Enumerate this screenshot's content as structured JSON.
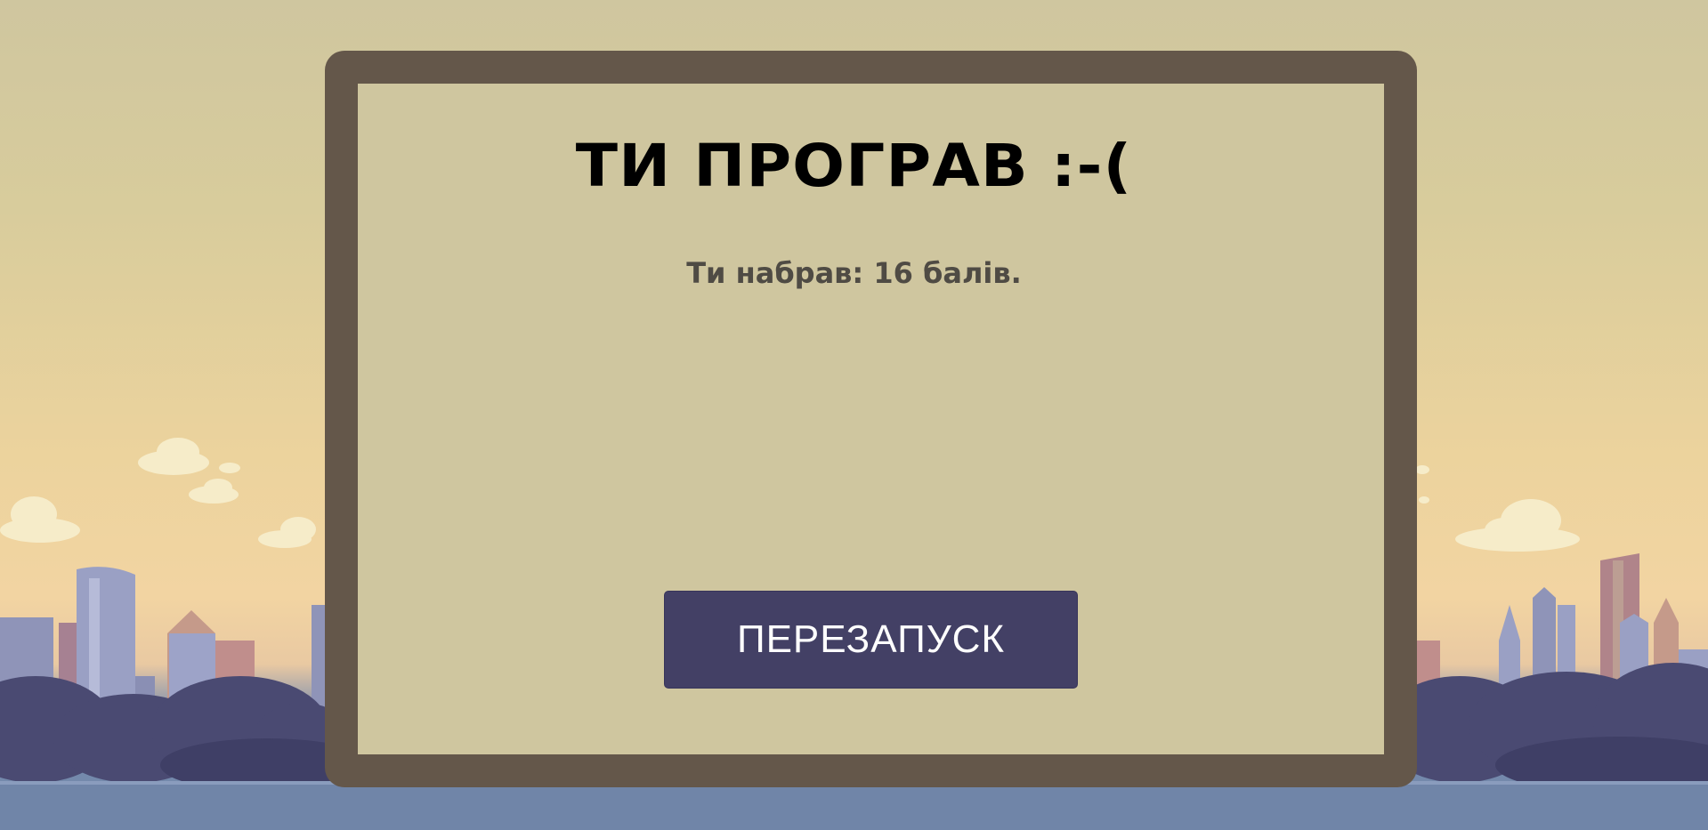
{
  "game_over": {
    "title": "ТИ ПРОГРАВ :-(",
    "score_text": "Ти набрав: 16 балів.",
    "score_value": 16,
    "restart_label": "ПЕРЕЗАПУСК"
  },
  "colors": {
    "sky": "#cfc69f",
    "panel_frame": "#64574a",
    "panel_fill": "#cfc69f",
    "button": "#434065",
    "button_text": "#ffffff",
    "title": "#000000",
    "score": "#4f4b44"
  }
}
